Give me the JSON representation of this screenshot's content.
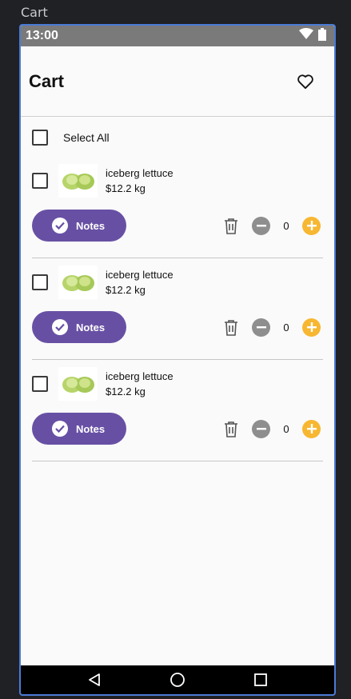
{
  "window": {
    "title": "Cart"
  },
  "status_bar": {
    "time": "13:00",
    "icons": [
      "wifi-icon",
      "battery-icon"
    ]
  },
  "app_bar": {
    "title": "Cart",
    "action_icon": "heart-icon"
  },
  "select_all": {
    "label": "Select All",
    "checked": false
  },
  "items": [
    {
      "name": "iceberg lettuce",
      "price": "$12.2 kg",
      "notes_label": "Notes",
      "quantity": "0",
      "checked": false
    },
    {
      "name": "iceberg lettuce",
      "price": "$12.2 kg",
      "notes_label": "Notes",
      "quantity": "0",
      "checked": false
    },
    {
      "name": "iceberg lettuce",
      "price": "$12.2 kg",
      "notes_label": "Notes",
      "quantity": "0",
      "checked": false
    }
  ],
  "colors": {
    "accent": "#6750a4",
    "plus": "#f7b731",
    "minus": "#8e8e8e",
    "device_border": "#4a7bd6"
  },
  "nav_bar": {
    "icons": [
      "back-icon",
      "home-icon",
      "recents-icon"
    ]
  }
}
